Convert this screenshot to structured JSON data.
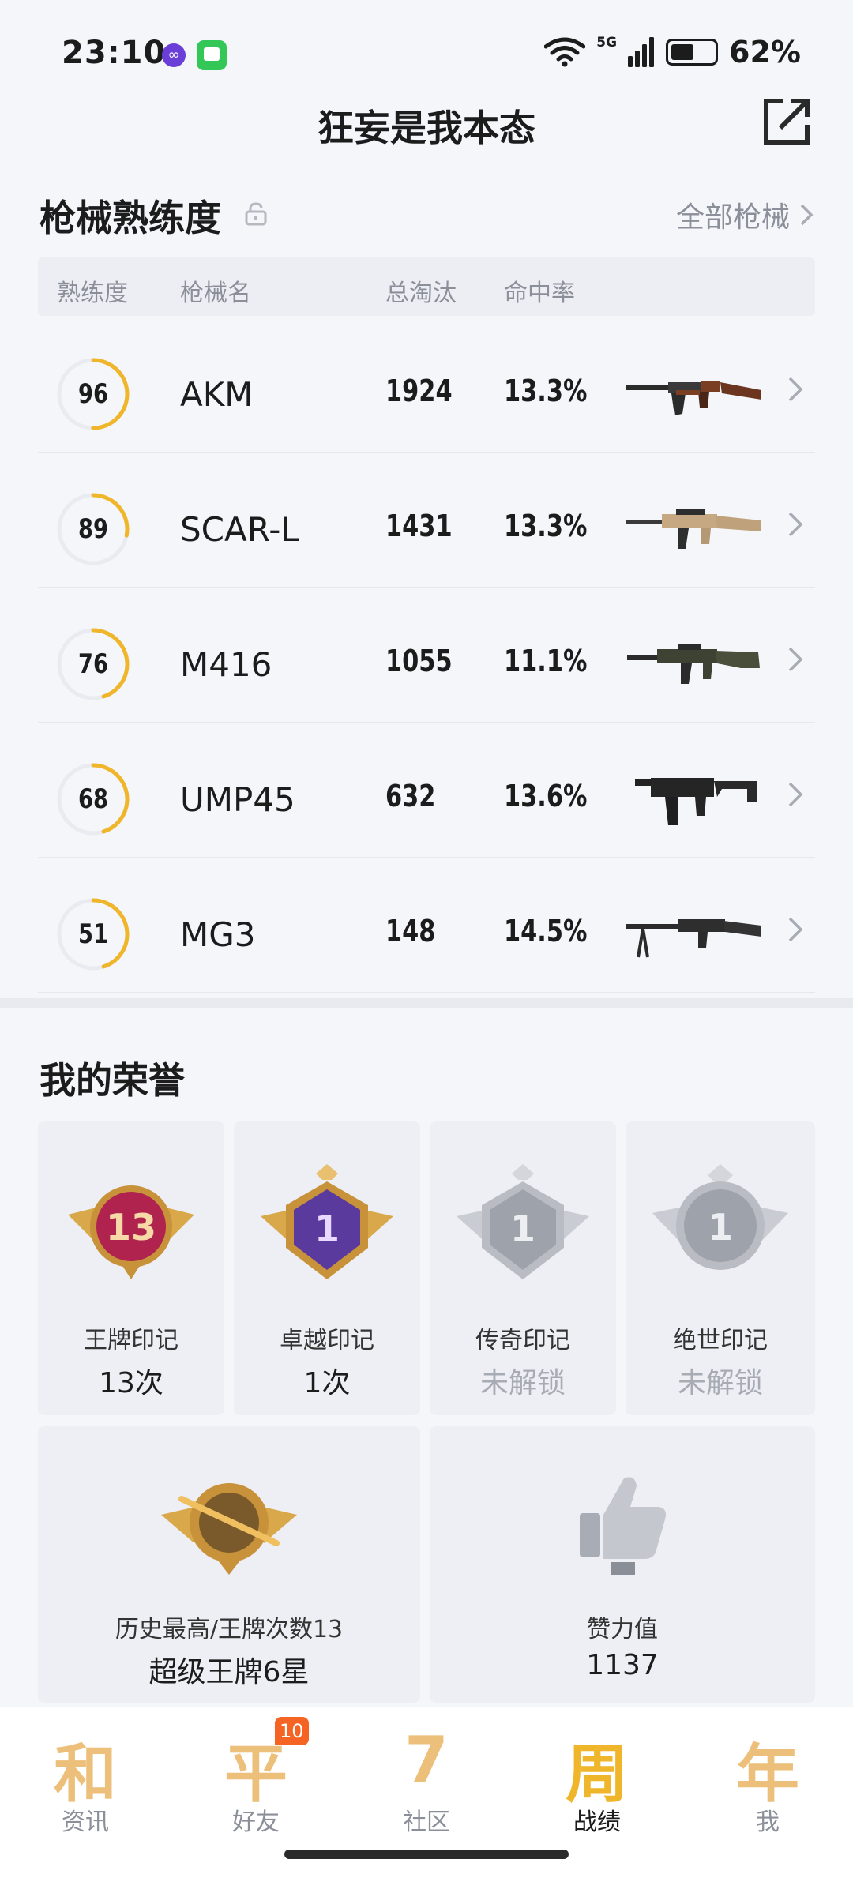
{
  "status": {
    "time": "23:10",
    "network": "5G",
    "battery": "62%",
    "battery_level": 0.62
  },
  "header": {
    "title": "狂妄是我本态"
  },
  "mastery": {
    "title": "枪械熟练度",
    "all_link": "全部枪械",
    "columns": [
      "熟练度",
      "枪械名",
      "总淘汰",
      "命中率"
    ],
    "rows": [
      {
        "level": "96",
        "progress": 0.5,
        "name": "AKM",
        "kills": "1924",
        "hit_rate": "13.3%",
        "gun_icon": "akm-rifle"
      },
      {
        "level": "89",
        "progress": 0.28,
        "name": "SCAR-L",
        "kills": "1431",
        "hit_rate": "13.3%",
        "gun_icon": "scar-rifle"
      },
      {
        "level": "76",
        "progress": 0.45,
        "name": "M416",
        "kills": "1055",
        "hit_rate": "11.1%",
        "gun_icon": "m416-rifle"
      },
      {
        "level": "68",
        "progress": 0.45,
        "name": "UMP45",
        "kills": "632",
        "hit_rate": "13.6%",
        "gun_icon": "ump45-smg"
      },
      {
        "level": "51",
        "progress": 0.45,
        "name": "MG3",
        "kills": "148",
        "hit_rate": "14.5%",
        "gun_icon": "mg3-lmg"
      }
    ]
  },
  "honors": {
    "title": "我的荣誉",
    "marks": [
      {
        "label": "王牌印记",
        "value": "13次",
        "badge_num": "13",
        "locked": false
      },
      {
        "label": "卓越印记",
        "value": "1次",
        "badge_num": "1",
        "locked": false
      },
      {
        "label": "传奇印记",
        "value": "未解锁",
        "badge_num": "1",
        "locked": true
      },
      {
        "label": "绝世印记",
        "value": "未解锁",
        "badge_num": "1",
        "locked": true
      }
    ],
    "highest": {
      "label": "历史最高/王牌次数13",
      "value": "超级王牌6星"
    },
    "likes": {
      "label": "赞力值",
      "value": "1137"
    }
  },
  "nav": [
    {
      "glyph": "和",
      "label": "资讯",
      "active": false
    },
    {
      "glyph": "平",
      "label": "好友",
      "active": false,
      "badge": "10"
    },
    {
      "glyph": "7",
      "label": "社区",
      "active": false
    },
    {
      "glyph": "周",
      "label": "战绩",
      "active": true
    },
    {
      "glyph": "年",
      "label": "我",
      "active": false
    }
  ],
  "colors": {
    "ring": "#f0b62b",
    "ring_track": "#e9ebf0",
    "badge": "#f56423"
  }
}
